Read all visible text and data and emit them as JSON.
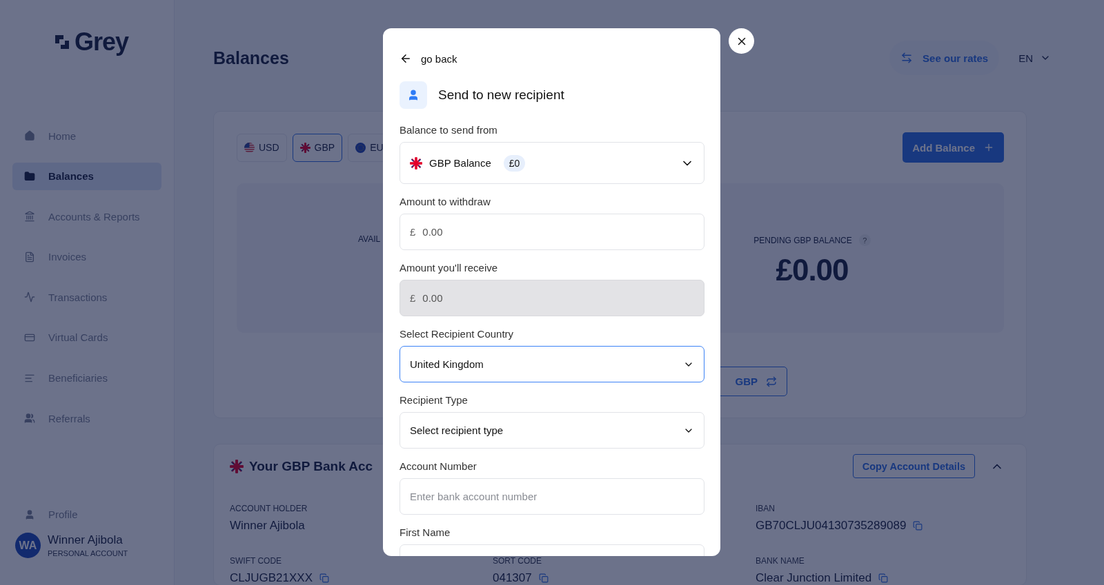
{
  "sidebar": {
    "logo": "Grey",
    "nav": [
      {
        "label": "Home",
        "selected": false
      },
      {
        "label": "Balances",
        "selected": true
      },
      {
        "label": "Accounts & Reports",
        "selected": false
      },
      {
        "label": "Invoices",
        "selected": false
      },
      {
        "label": "Transactions",
        "selected": false
      },
      {
        "label": "Virtual Cards",
        "selected": false
      },
      {
        "label": "Beneficiaries",
        "selected": false
      },
      {
        "label": "Referrals",
        "selected": false
      }
    ],
    "profile": "Profile",
    "user": {
      "initials": "WA",
      "name": "Winner Ajibola",
      "account_type": "PERSONAL ACCOUNT"
    }
  },
  "header": {
    "title": "Balances",
    "rates_button": "See our rates",
    "language": "EN"
  },
  "balances": {
    "currency_tabs": [
      {
        "label": "USD",
        "selected": false
      },
      {
        "label": "GBP",
        "selected": true
      },
      {
        "label": "EU",
        "selected": false
      }
    ],
    "add_button": "Add Balance",
    "available_label": "AVAIL",
    "pending_label": "PENDING GBP BALANCE",
    "pending_help": "?",
    "pending_amount": "£0.00",
    "convert_button": "GBP"
  },
  "bank_account": {
    "title": "Your GBP Bank Acc",
    "copy_button": "Copy Account Details",
    "expanded": true,
    "fields": [
      {
        "label": "ACCOUNT HOLDER",
        "value": "Winner Ajibola",
        "copyable": false
      },
      {
        "label": "IBAN",
        "value": "GB70CLJU04130735289089",
        "copyable": true
      },
      {
        "label": "SWIFT CODE",
        "value": "CLJUGB21XXX",
        "copyable": true
      },
      {
        "label": "SORT CODE",
        "value": "041307",
        "copyable": true
      },
      {
        "label": "BANK NAME",
        "value": "Clear Junction Limited",
        "copyable": true
      }
    ]
  },
  "modal": {
    "back": "go back",
    "title": "Send to new recipient",
    "fields": [
      {
        "kind": "balance_select",
        "label": "Balance to send from",
        "value": "GBP Balance",
        "badge": "£0",
        "focused": false,
        "disabled": false
      },
      {
        "kind": "amount",
        "label": "Amount to withdraw",
        "prefix": "£",
        "value": "0.00",
        "focused": false,
        "disabled": false
      },
      {
        "kind": "amount",
        "label": "Amount you'll receive",
        "prefix": "£",
        "value": "0.00",
        "focused": false,
        "disabled": true
      },
      {
        "kind": "select",
        "label": "Select Recipient Country",
        "value": "United Kingdom",
        "focused": true,
        "disabled": false
      },
      {
        "kind": "select",
        "label": "Recipient Type",
        "value": "Select recipient type",
        "focused": false,
        "disabled": false
      },
      {
        "kind": "text",
        "label": "Account Number",
        "placeholder": "Enter bank account number",
        "focused": false,
        "disabled": false
      },
      {
        "kind": "text",
        "label": "First Name",
        "focused": false,
        "disabled": false
      }
    ]
  }
}
